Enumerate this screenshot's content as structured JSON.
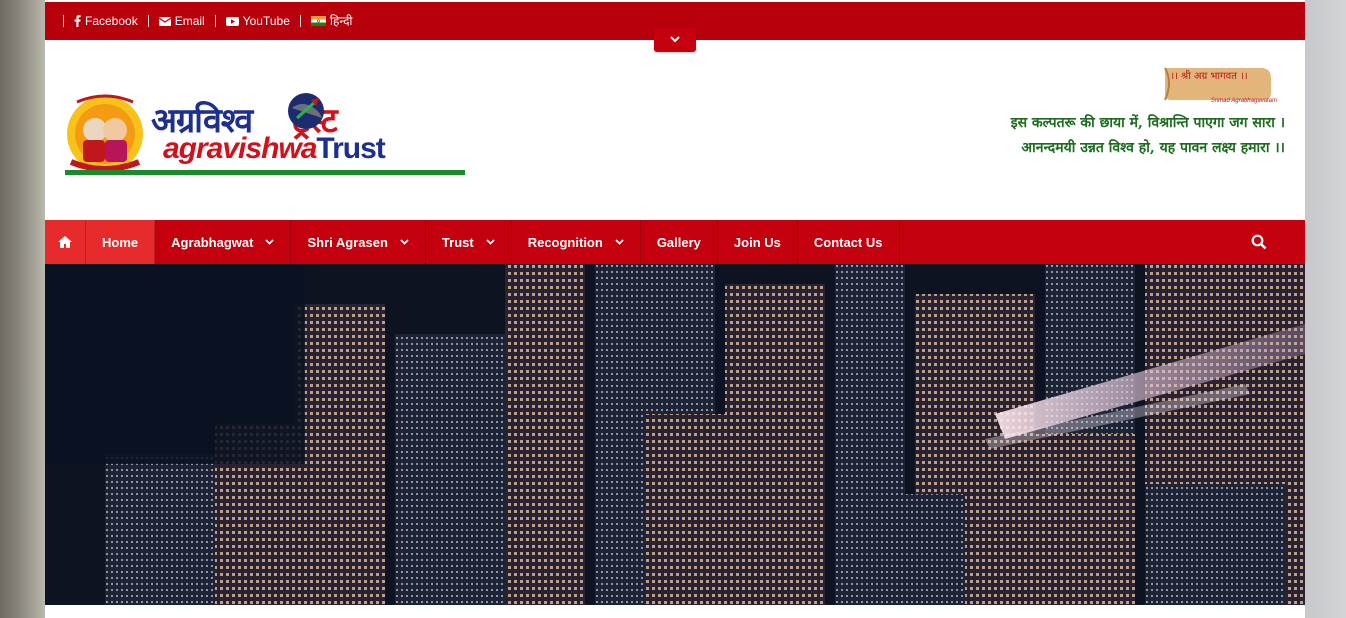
{
  "topbar": {
    "links": [
      {
        "label": "Facebook",
        "icon": "facebook-icon"
      },
      {
        "label": "Email",
        "icon": "envelope-icon"
      },
      {
        "label": "YouTube",
        "icon": "youtube-icon"
      },
      {
        "label": "हिन्दी",
        "icon": "india-flag-icon"
      }
    ]
  },
  "header": {
    "logo": {
      "hindi_a": "अग्रविश्व",
      "hindi_b": "ट्रस्ट",
      "eng_a": "agravishwa",
      "eng_b": "Trust"
    },
    "tagline": {
      "banner_text": "।। श्री अग्र भागवत ।।",
      "banner_sub": "Srimad Agrabhagavatam",
      "line1": "इस कल्पतरू की छाया में, विश्रान्ति पाएगा जग सारा ।",
      "line2": "आनन्दमयी उन्नत विश्व हो, यह पावन लक्ष्य हमारा ।।"
    }
  },
  "nav": {
    "items": [
      {
        "label": "Home",
        "dropdown": false,
        "active": true
      },
      {
        "label": "Agrabhagwat",
        "dropdown": true
      },
      {
        "label": "Shri Agrasen",
        "dropdown": true
      },
      {
        "label": "Trust",
        "dropdown": true
      },
      {
        "label": "Recognition",
        "dropdown": true
      },
      {
        "label": "Gallery",
        "dropdown": false
      },
      {
        "label": "Join Us",
        "dropdown": false
      },
      {
        "label": "Contact Us",
        "dropdown": false
      }
    ]
  },
  "colors": {
    "primary_red": "#c4000e",
    "active_red": "#e52b2b",
    "topbar_red": "#b8000c",
    "tagline_green": "#1d6b1f",
    "logo_blue": "#1d2f8f"
  }
}
